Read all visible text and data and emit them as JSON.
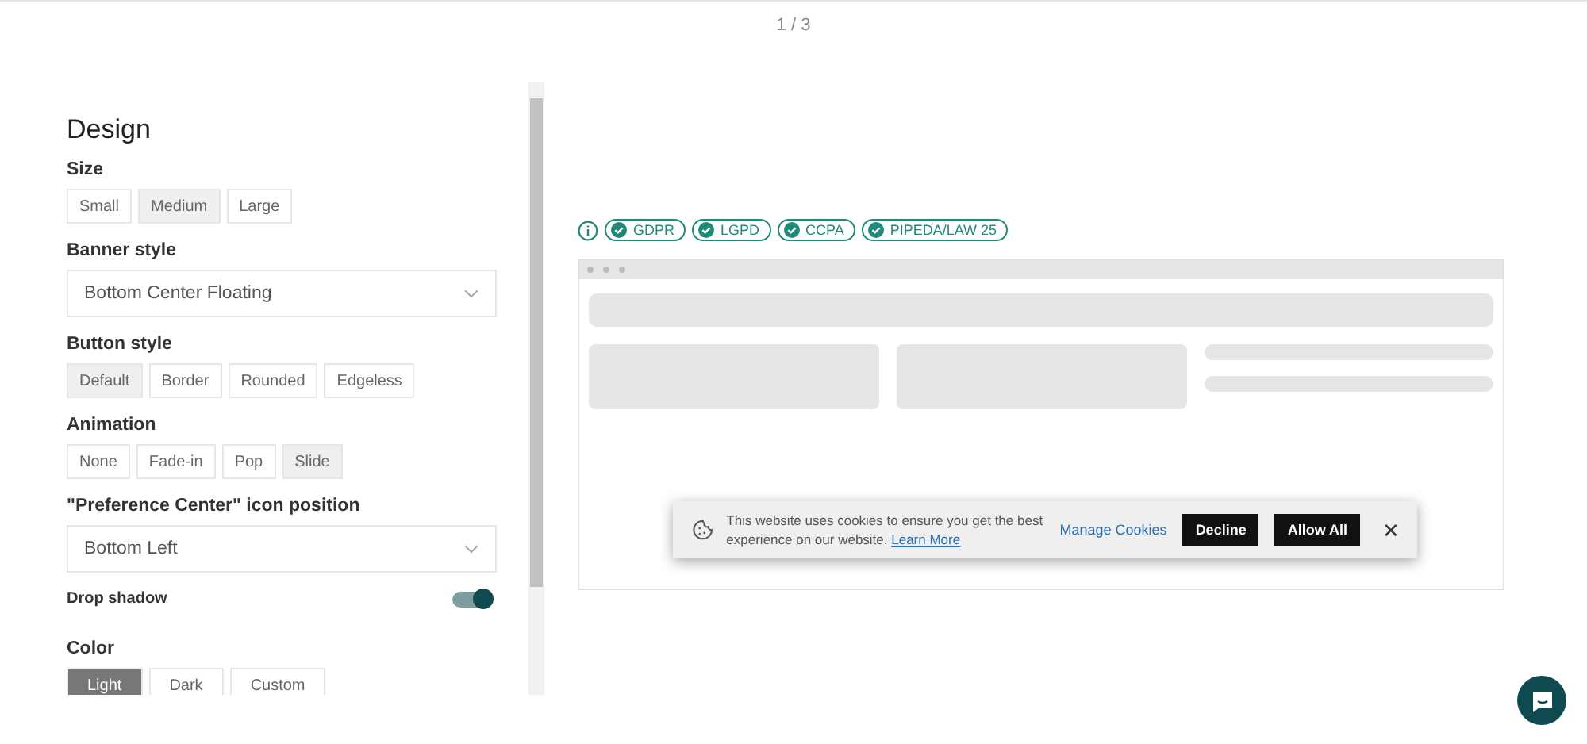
{
  "pager": "1 / 3",
  "panel": {
    "title": "Design",
    "sections": [
      {
        "kind": "segmented",
        "label": "Size",
        "options": [
          {
            "label": "Small",
            "selected": false
          },
          {
            "label": "Medium",
            "selected": true
          },
          {
            "label": "Large",
            "selected": false
          }
        ]
      },
      {
        "kind": "select",
        "label": "Banner style",
        "value": "Bottom Center Floating"
      },
      {
        "kind": "segmented",
        "label": "Button style",
        "options": [
          {
            "label": "Default",
            "selected": true
          },
          {
            "label": "Border",
            "selected": false
          },
          {
            "label": "Rounded",
            "selected": false
          },
          {
            "label": "Edgeless",
            "selected": false
          }
        ]
      },
      {
        "kind": "segmented",
        "label": "Animation",
        "options": [
          {
            "label": "None",
            "selected": false
          },
          {
            "label": "Fade-in",
            "selected": false
          },
          {
            "label": "Pop",
            "selected": false
          },
          {
            "label": "Slide",
            "selected": true
          }
        ]
      },
      {
        "kind": "select",
        "label": "\"Preference Center\" icon position",
        "value": "Bottom Left"
      },
      {
        "kind": "toggle",
        "label": "Drop shadow",
        "on": true
      },
      {
        "kind": "color",
        "label": "Color",
        "options": [
          {
            "label": "Light",
            "selected": true
          },
          {
            "label": "Dark",
            "selected": false
          },
          {
            "label": "Custom",
            "selected": false
          }
        ]
      }
    ]
  },
  "laws": [
    "GDPR",
    "LGPD",
    "CCPA",
    "PIPEDA/LAW 25"
  ],
  "banner": {
    "text": "This website uses cookies to ensure you get the best experience on our website.",
    "link": "Learn More",
    "manage": "Manage Cookies",
    "decline": "Decline",
    "allow": "Allow All",
    "close": "✕"
  }
}
